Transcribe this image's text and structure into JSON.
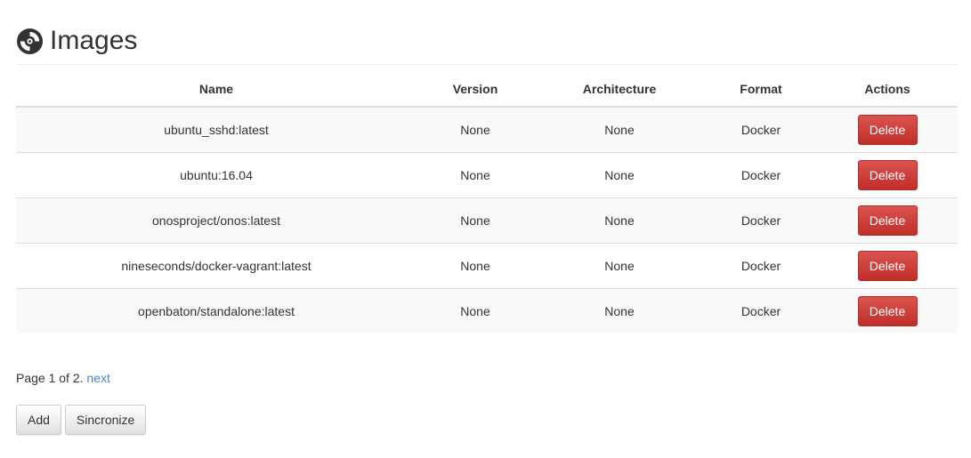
{
  "header": {
    "title": "Images",
    "icon": "disc-icon"
  },
  "table": {
    "columns": [
      "Name",
      "Version",
      "Architecture",
      "Format",
      "Actions"
    ],
    "rows": [
      {
        "name": "ubuntu_sshd:latest",
        "version": "None",
        "architecture": "None",
        "format": "Docker",
        "action": "Delete"
      },
      {
        "name": "ubuntu:16.04",
        "version": "None",
        "architecture": "None",
        "format": "Docker",
        "action": "Delete"
      },
      {
        "name": "onosproject/onos:latest",
        "version": "None",
        "architecture": "None",
        "format": "Docker",
        "action": "Delete"
      },
      {
        "name": "nineseconds/docker-vagrant:latest",
        "version": "None",
        "architecture": "None",
        "format": "Docker",
        "action": "Delete"
      },
      {
        "name": "openbaton/standalone:latest",
        "version": "None",
        "architecture": "None",
        "format": "Docker",
        "action": "Delete"
      }
    ]
  },
  "pagination": {
    "text": "Page 1 of 2.",
    "next_label": "next"
  },
  "buttons": {
    "add_label": "Add",
    "sync_label": "Sincronize"
  },
  "colors": {
    "danger": "#d9534f",
    "link": "#428bca",
    "stripe": "#f9f9f9"
  }
}
